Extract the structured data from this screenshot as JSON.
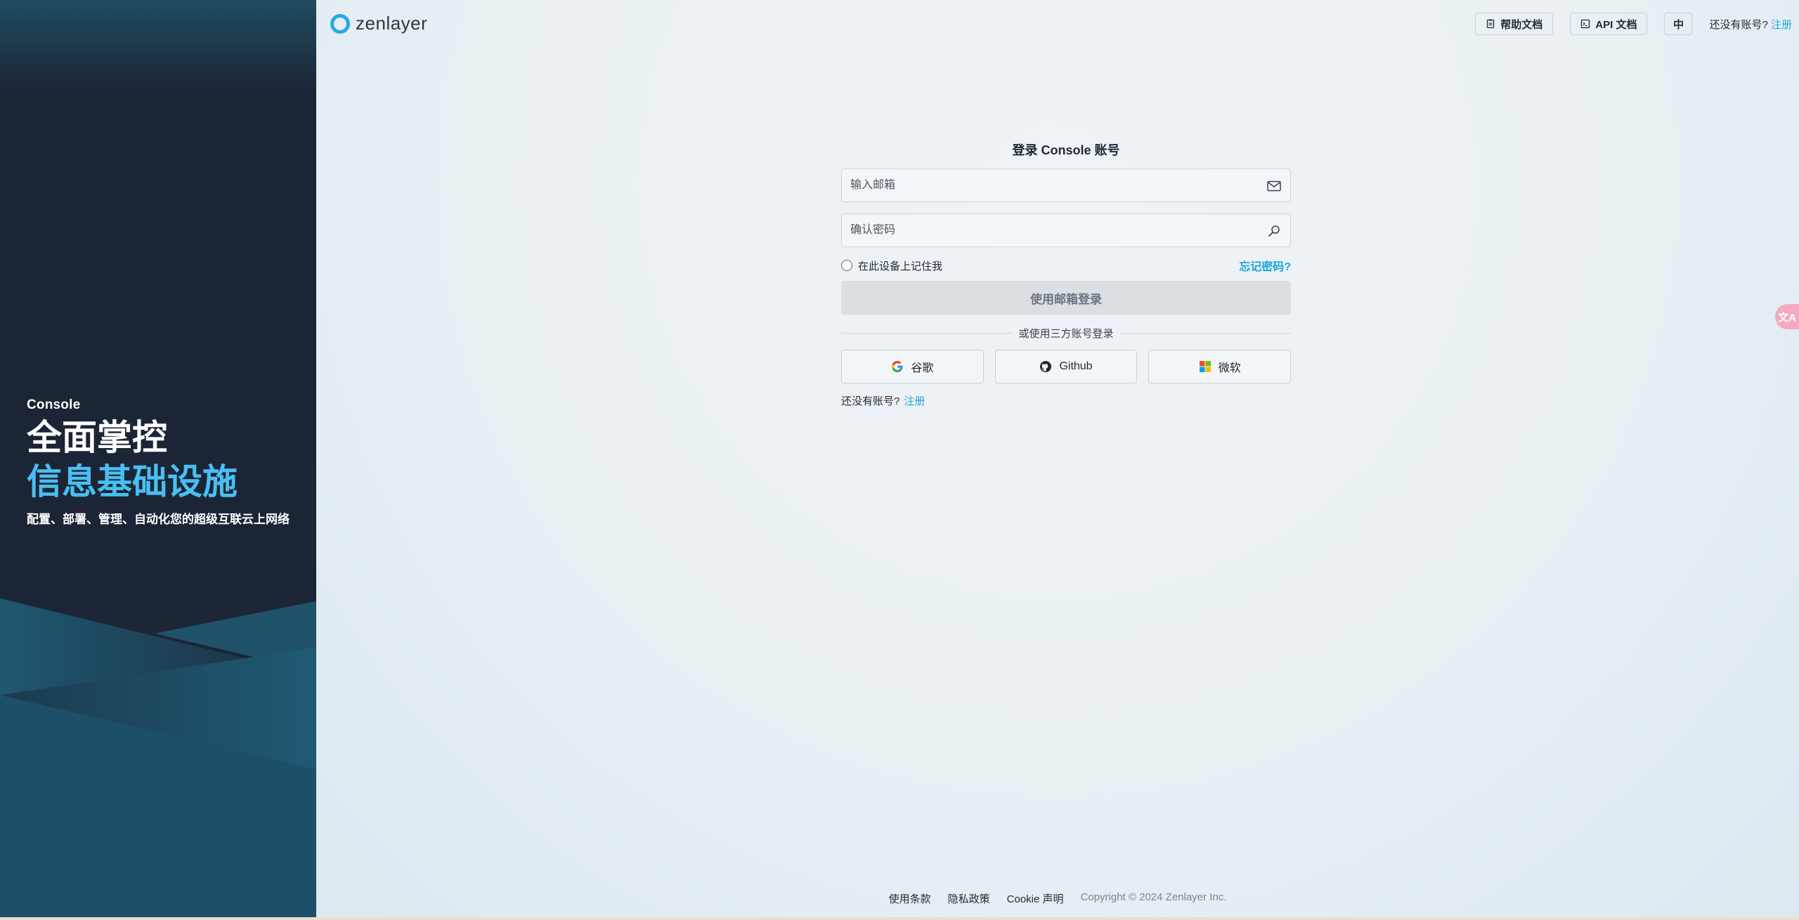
{
  "left": {
    "eyebrow": "Console",
    "title_line1": "全面掌控",
    "title_line2": "信息基础设施",
    "subtitle": "配置、部署、管理、自动化您的超级互联云上网络"
  },
  "header": {
    "logo_text": "zenlayer",
    "help_docs": "帮助文档",
    "api_docs": "API 文档",
    "lang": "中",
    "no_account": "还没有账号?",
    "signup": "注册"
  },
  "login": {
    "title": "登录 Console 账号",
    "email_placeholder": "输入邮箱",
    "password_placeholder": "确认密码",
    "remember": "在此设备上记住我",
    "forgot": "忘记密码?",
    "submit": "使用邮箱登录",
    "divider": "或使用三方账号登录",
    "google": "谷歌",
    "github": "Github",
    "microsoft": "微软",
    "no_account": "还没有账号?",
    "signup": "注册"
  },
  "footer": {
    "terms": "使用条款",
    "privacy": "隐私政策",
    "cookie": "Cookie 声明",
    "copyright": "Copyright © 2024 Zenlayer Inc."
  },
  "float": {
    "translate_label": "文A"
  },
  "colors": {
    "accent": "#20a8d8",
    "brand_blue": "#48bff2",
    "panel_dark": "#1c2536"
  }
}
